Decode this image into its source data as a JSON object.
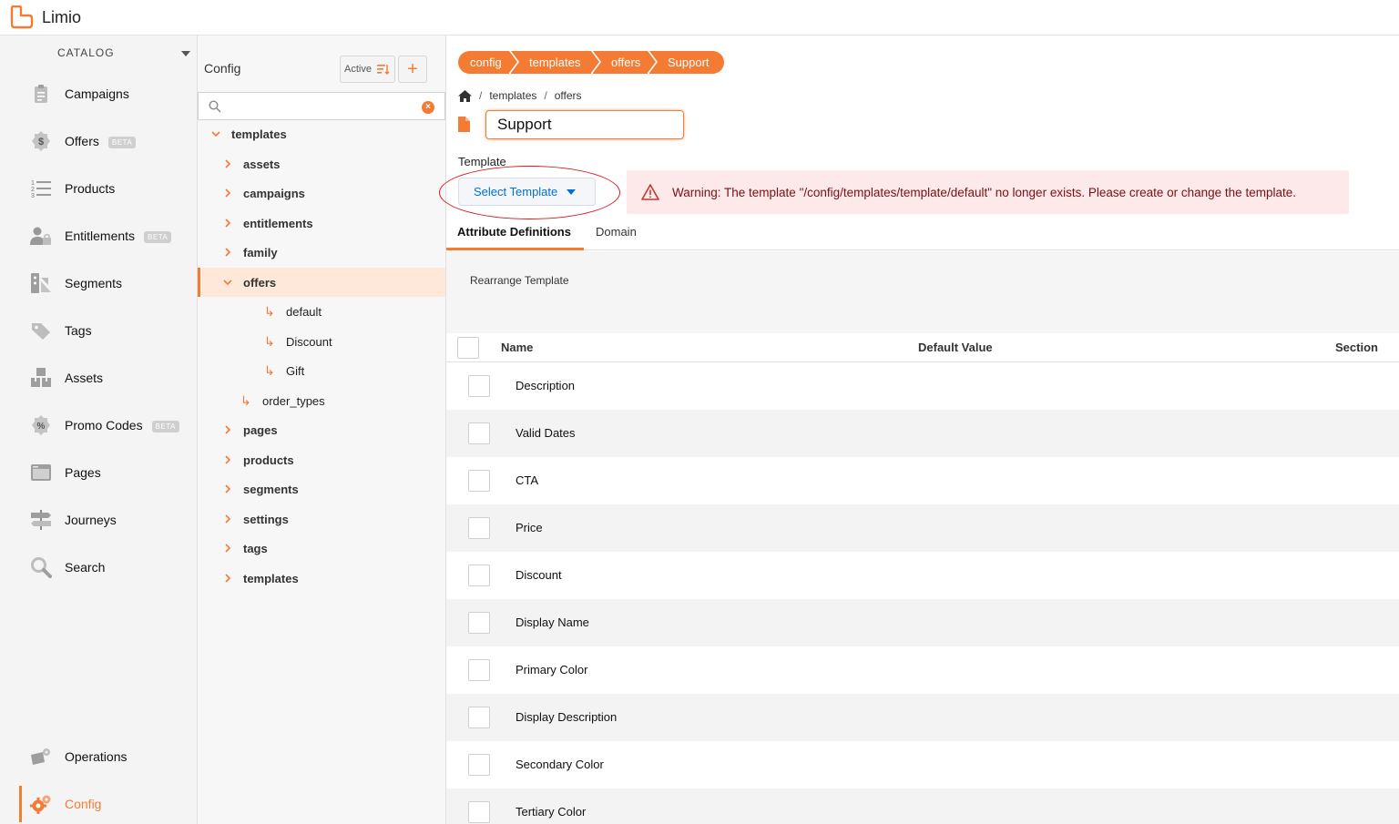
{
  "app": {
    "name": "Limio"
  },
  "leftnav": {
    "section_label": "CATALOG",
    "items": [
      {
        "label": "Campaigns",
        "icon": "clipboard-icon",
        "beta": ""
      },
      {
        "label": "Offers",
        "icon": "dollar-badge-icon",
        "beta": "BETA"
      },
      {
        "label": "Products",
        "icon": "numbered-list-icon",
        "beta": ""
      },
      {
        "label": "Entitlements",
        "icon": "user-lock-icon",
        "beta": "BETA"
      },
      {
        "label": "Segments",
        "icon": "segments-icon",
        "beta": ""
      },
      {
        "label": "Tags",
        "icon": "tag-icon",
        "beta": ""
      },
      {
        "label": "Assets",
        "icon": "boxes-icon",
        "beta": ""
      },
      {
        "label": "Promo Codes",
        "icon": "percent-badge-icon",
        "beta": "BETA"
      },
      {
        "label": "Pages",
        "icon": "browser-window-icon",
        "beta": ""
      },
      {
        "label": "Journeys",
        "icon": "signpost-icon",
        "beta": ""
      },
      {
        "label": "Search",
        "icon": "magnifier-icon",
        "beta": ""
      }
    ],
    "bottom_items": [
      {
        "label": "Operations",
        "icon": "operations-icon"
      },
      {
        "label": "Config",
        "icon": "gears-icon"
      }
    ]
  },
  "tree": {
    "title": "Config",
    "active_button": "Active",
    "search_placeholder": "",
    "rows": [
      {
        "label": "templates"
      },
      {
        "label": "assets"
      },
      {
        "label": "campaigns"
      },
      {
        "label": "entitlements"
      },
      {
        "label": "family"
      },
      {
        "label": "offers"
      },
      {
        "label": "default"
      },
      {
        "label": "Discount"
      },
      {
        "label": "Gift"
      },
      {
        "label": "order_types"
      },
      {
        "label": "pages"
      },
      {
        "label": "products"
      },
      {
        "label": "segments"
      },
      {
        "label": "settings"
      },
      {
        "label": "tags"
      },
      {
        "label": "templates"
      }
    ]
  },
  "main": {
    "path": [
      "config",
      "templates",
      "offers",
      "Support"
    ],
    "breadcrumb": [
      "templates",
      "offers"
    ],
    "name_value": "Support",
    "template_label": "Template",
    "select_template": "Select Template",
    "warning": "Warning: The template \"/config/templates/template/default\" no longer exists. Please create or change the template.",
    "tabs": [
      "Attribute Definitions",
      "Domain"
    ],
    "rearrange": "Rearrange Template",
    "table": {
      "headers": {
        "name": "Name",
        "default": "Default Value",
        "section": "Section"
      },
      "rows": [
        "Description",
        "Valid Dates",
        "CTA",
        "Price",
        "Discount",
        "Display Name",
        "Primary Color",
        "Display Description",
        "Secondary Color",
        "Tertiary Color"
      ]
    }
  },
  "colors": {
    "accent": "#f47b33",
    "link": "#0070d2",
    "warning_bg": "#fde9e9",
    "warning_text": "#7a1011",
    "annotation": "#d9181f"
  }
}
